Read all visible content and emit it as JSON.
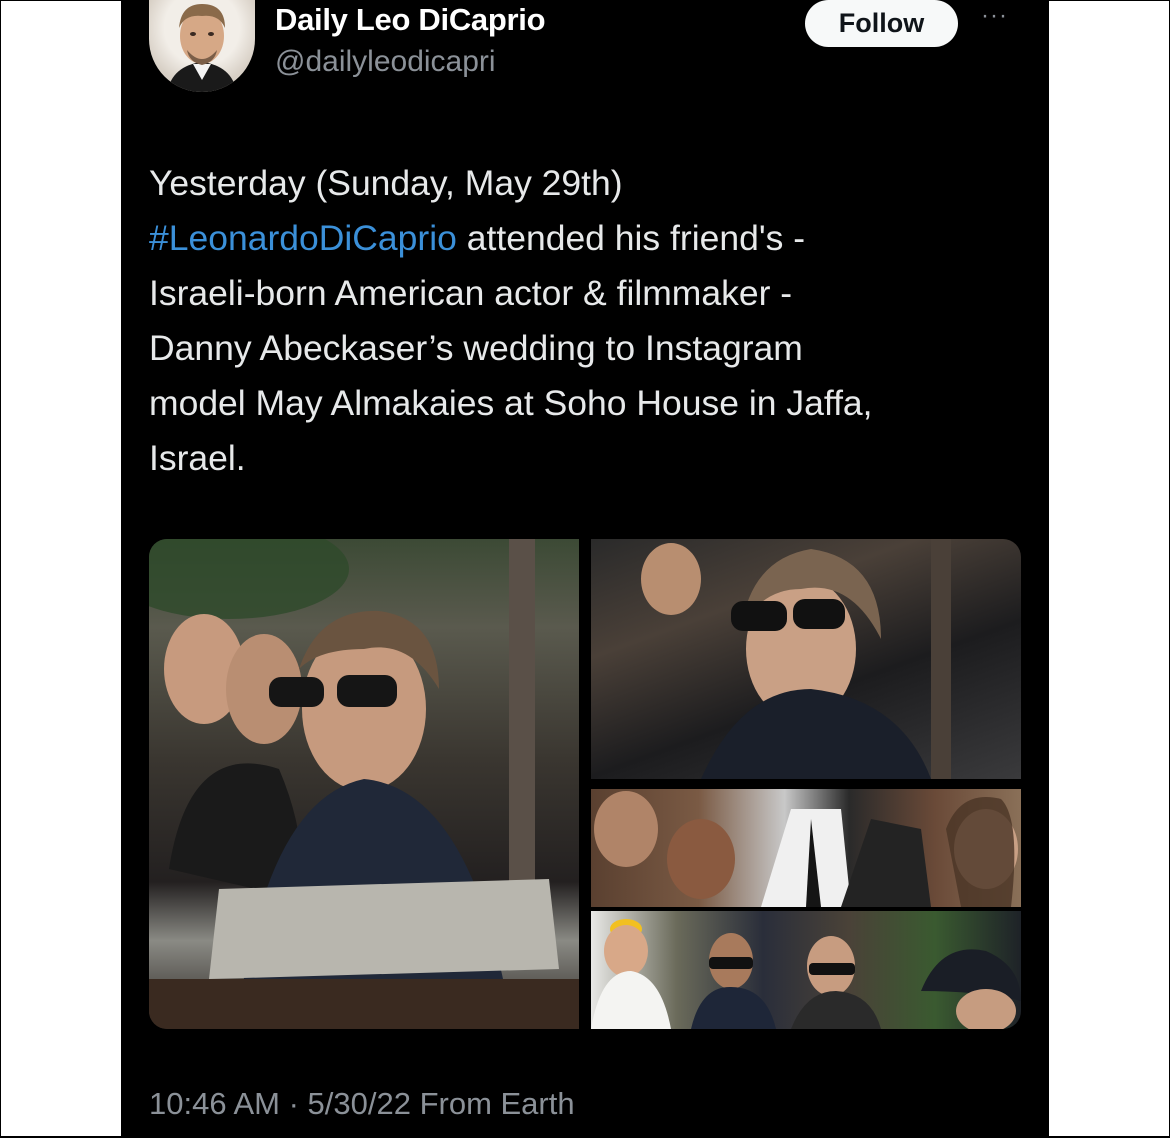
{
  "account": {
    "display_name": "Daily Leo DiCaprio",
    "handle": "@dailyleodicapri",
    "follow_label": "Follow",
    "more_label": "···"
  },
  "tweet": {
    "line1": "Yesterday (Sunday, May 29th)",
    "hashtag": "#LeonardoDiCaprio",
    "line2_rest": " attended his friend's -",
    "line3": "Israeli-born American actor & filmmaker -",
    "line4": "Danny Abeckaser’s wedding to Instagram",
    "line5": "model May Almakaies at Soho House in Jaffa,",
    "line6": "Israel.",
    "timestamp": "10:46 AM · 5/30/22 From Earth"
  },
  "media": {
    "photos": [
      {
        "name": "main"
      },
      {
        "name": "top-right"
      },
      {
        "name": "middle-right"
      },
      {
        "name": "bottom-right"
      }
    ]
  },
  "colors": {
    "background": "#000000",
    "text": "#e7e9ea",
    "secondary_text": "#8b9198",
    "hashtag": "#3b90d9",
    "follow_button_bg": "#f7f9f9"
  }
}
